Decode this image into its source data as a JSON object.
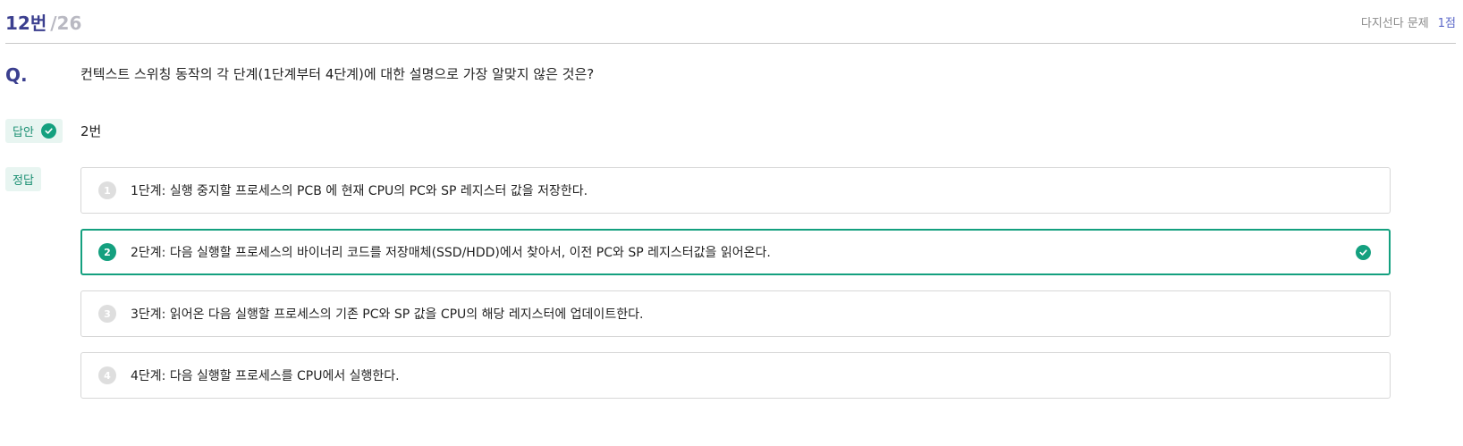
{
  "header": {
    "question_number": "12번",
    "question_total": "/26",
    "question_type": "다지선다 문제",
    "points": "1점"
  },
  "question": {
    "marker": "Q.",
    "text": "컨텍스트 스위칭 동작의 각 단계(1단계부터 4단계)에 대한 설명으로 가장 알맞지 않은 것은?"
  },
  "answer": {
    "label": "답안",
    "value": "2번"
  },
  "correct": {
    "label": "정답"
  },
  "options": [
    {
      "number": "1",
      "text": "1단계: 실행 중지할 프로세스의 PCB 에 현재 CPU의 PC와 SP 레지스터 값을 저장한다."
    },
    {
      "number": "2",
      "text": "2단계: 다음 실행할 프로세스의 바이너리 코드를 저장매체(SSD/HDD)에서 찾아서, 이전 PC와 SP 레지스터값을 읽어온다."
    },
    {
      "number": "3",
      "text": "3단계: 읽어온 다음 실행할 프로세스의 기존 PC와 SP 값을 CPU의 해당 레지스터에 업데이트한다."
    },
    {
      "number": "4",
      "text": "4단계: 다음 실행할 프로세스를 CPU에서 실행한다."
    }
  ],
  "colors": {
    "accent": "#14a07f",
    "title": "#3b3f8f",
    "points": "#5a67c8"
  },
  "icons": {
    "answer_status": "check-circle-icon",
    "selected_option": "check-circle-icon"
  }
}
